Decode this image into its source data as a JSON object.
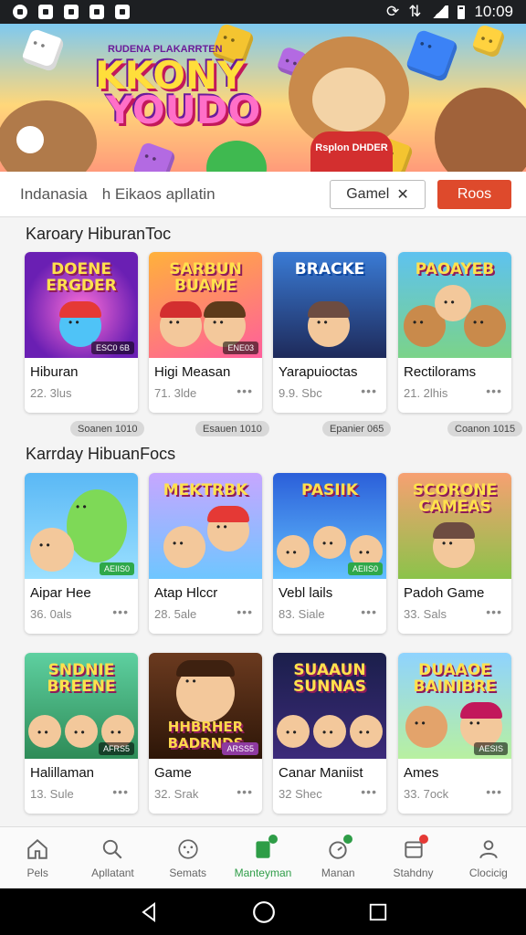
{
  "status_bar": {
    "time": "10:09"
  },
  "hero": {
    "logo_line1": "KKONY",
    "logo_line2": "YOUDO",
    "subtitle": "RUDENA PLAKARRTEN",
    "shirt_text": "Rsplon DHDER"
  },
  "tabs": [
    {
      "label": "Indanasia"
    },
    {
      "label": "h Eikaos apllatin"
    }
  ],
  "filter_chip": {
    "label": "Gamel"
  },
  "action_button": {
    "label": "Roos"
  },
  "sections": [
    {
      "title": "Karoary HiburanToc",
      "cards": [
        {
          "title": "Hiburan",
          "meta": "22. 3lus",
          "art": "DOENE ERGDER",
          "badge": "ESC0 6B"
        },
        {
          "title": "Higi Measan",
          "meta": "71. 3lde",
          "art": "SARBUN BUAME",
          "badge": "ENE03"
        },
        {
          "title": "Yarapuioctas",
          "meta": "9.9. Sbc",
          "art": "BRACKE",
          "badge": ""
        },
        {
          "title": "Rectilorams",
          "meta": "21. 2lhis",
          "art": "PAOAYEB",
          "badge": ""
        }
      ],
      "pills": [
        "Soanen 1010",
        "Esauen 1010",
        "Epanier 065",
        "Coanon 1015"
      ]
    },
    {
      "title": "Karrday HibuanFocs",
      "cards": [
        {
          "title": "Aipar Hee",
          "meta": "36. 0als",
          "art": "",
          "badge": "AEIIS0"
        },
        {
          "title": "Atap Hlccr",
          "meta": "28. 5ale",
          "art": "MEKTRBK",
          "badge": ""
        },
        {
          "title": "Vebl lails",
          "meta": "83. Siale",
          "art": "PASIIK",
          "badge": "AEIIS0"
        },
        {
          "title": "Padoh Game",
          "meta": "33. Sals",
          "art": "SCORONE CAMEAS",
          "badge": ""
        }
      ]
    },
    {
      "cards": [
        {
          "title": "Halillaman",
          "meta": "13. Sule",
          "art": "SNDNIE BREENE",
          "badge": "AFRS5"
        },
        {
          "title": "Game",
          "meta": "32. Srak",
          "art": "HHBRHER BADRNDS",
          "badge": "ARSS5"
        },
        {
          "title": "Canar Maniist",
          "meta": "32 Shec",
          "art": "SUAAUN SUNNAS",
          "badge": ""
        },
        {
          "title": "Ames",
          "meta": "33. 7ock",
          "art": "DUAAOE BAINIBRE",
          "badge": "AESIS"
        }
      ]
    }
  ],
  "bottom_nav": [
    {
      "label": "Pels",
      "icon": "home-icon"
    },
    {
      "label": "Apllatant",
      "icon": "search-icon"
    },
    {
      "label": "Semats",
      "icon": "dots-circle-icon"
    },
    {
      "label": "Manteyman",
      "icon": "tablet-icon"
    },
    {
      "label": "Manan",
      "icon": "timer-icon"
    },
    {
      "label": "Stahdny",
      "icon": "calendar-icon"
    },
    {
      "label": "Clocicig",
      "icon": "person-icon"
    }
  ],
  "colors": {
    "accent_green": "#2e9d47",
    "action_red": "#de4a2c",
    "status_bar": "#1d1f22"
  }
}
